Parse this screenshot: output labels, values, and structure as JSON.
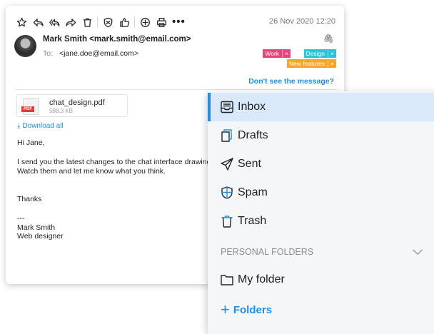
{
  "email": {
    "date": "26 Nov 2020 12:20",
    "sender": "Mark Smith <mark.smith@email.com>",
    "to_label": "To:",
    "to_value": "<jane.doe@email.com>",
    "tags": [
      {
        "label": "Work",
        "remove": "×",
        "color": "#e8457b"
      },
      {
        "label": "Design",
        "remove": "×",
        "color": "#2bc3d8"
      },
      {
        "label": "New features",
        "remove": "×",
        "color": "#f5a623"
      }
    ],
    "dont_see_link": "Don't see the message?",
    "attachment": {
      "badge": "PDF",
      "name": "chat_design.pdf",
      "size": "588.3 KB"
    },
    "download_all": "Download all",
    "body_lines": [
      "Hi Jane,",
      "I send you the latest changes to the chat interface drawings.",
      "Watch them and let me know what you think.",
      "Thanks",
      "---",
      "Mark Smith",
      "Web designer"
    ]
  },
  "toolbar": {
    "more": "•••",
    "icons": [
      "star-icon",
      "reply-icon",
      "reply-all-icon",
      "forward-icon",
      "delete-icon",
      "spam-icon",
      "like-icon",
      "add-icon",
      "print-icon",
      "more-icon"
    ]
  },
  "folders": {
    "items": [
      {
        "label": "Inbox",
        "active": true
      },
      {
        "label": "Drafts"
      },
      {
        "label": "Sent"
      },
      {
        "label": "Spam"
      },
      {
        "label": "Trash"
      }
    ],
    "personal_header": "PERSONAL FOLDERS",
    "personal_items": [
      {
        "label": "My folder"
      }
    ],
    "add_label": "Folders",
    "add_symbol": "+"
  },
  "colors": {
    "accent": "#1f8fe4",
    "active_bg": "#d9e8fb"
  }
}
